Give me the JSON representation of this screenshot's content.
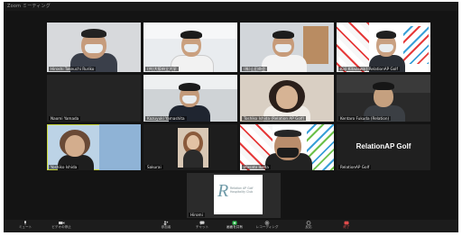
{
  "window": {
    "title": "Zoom ミーティング"
  },
  "participants": [
    {
      "name": "Hiroshi Takeuchi Ruriko",
      "tile": "t1"
    },
    {
      "name": "(共)大阪府立大学",
      "tile": "t2"
    },
    {
      "name": "(株)山田商会",
      "tile": "t3"
    },
    {
      "name": "Koji Kitazawa | RelationAP Golf",
      "tile": "t4"
    },
    {
      "name": "Naomi Yamada",
      "tile": "t5"
    },
    {
      "name": "Kazuyuki Yamashita",
      "tile": "t6"
    },
    {
      "name": "Toshiko Ishida (Relation AP Golf)",
      "tile": "t7"
    },
    {
      "name": "Kentaro Fukuda (Relation)",
      "tile": "t8"
    },
    {
      "name": "Yoshiko Ishida",
      "tile": "t9"
    },
    {
      "name": "Sakurai",
      "tile": "t10"
    },
    {
      "name": "Masato Ikeda",
      "tile": "t11"
    },
    {
      "name": "RelationAP Golf",
      "tile": "t12"
    },
    {
      "name": "Hiromi",
      "tile": "t13"
    }
  ],
  "tile12": {
    "label": "RelationAP Golf",
    "nametag": "RelationAP Golf"
  },
  "tile13": {
    "logo_letter": "R",
    "logo_text": "Relation AP Golf Hospitality Club"
  },
  "toolbar": {
    "buttons": [
      {
        "label": "ミュート",
        "icon": "microphone-icon"
      },
      {
        "label": "ビデオの停止",
        "icon": "video-camera-icon"
      },
      {
        "label": "参加者",
        "icon": "participants-icon"
      },
      {
        "label": "チャット",
        "icon": "chat-icon"
      },
      {
        "label": "画面を共有",
        "icon": "share-screen-icon"
      },
      {
        "label": "レコーディング",
        "icon": "record-icon"
      },
      {
        "label": "反応",
        "icon": "reactions-icon"
      },
      {
        "label": "終了",
        "icon": "leave-icon"
      }
    ]
  },
  "colors": {
    "speaking": "#c8d73a",
    "background": "#121212",
    "share": "#2fbf4f",
    "leave": "#e14b4b"
  }
}
